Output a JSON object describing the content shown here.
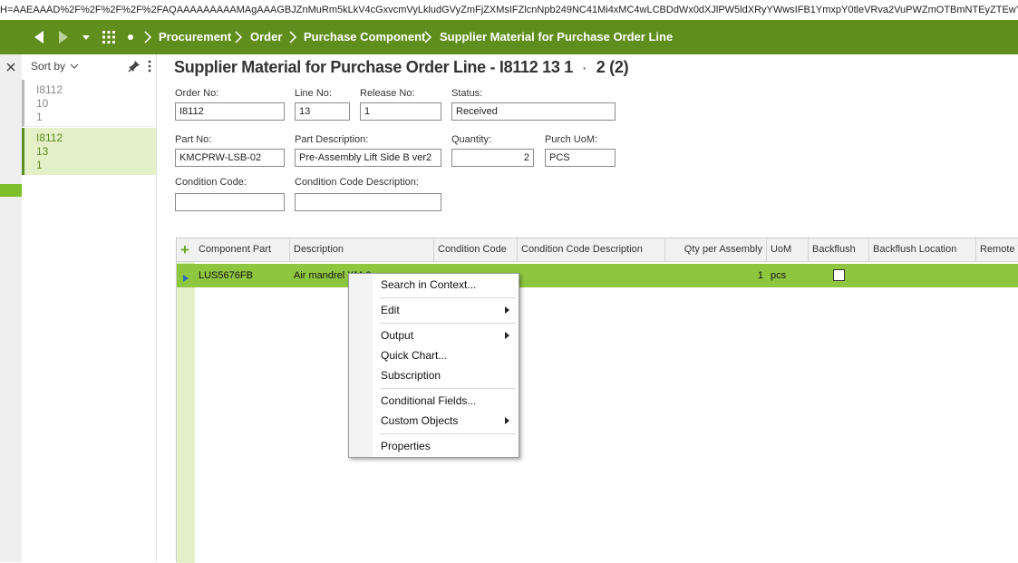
{
  "url": "H=AAEAAAD%2F%2F%2F%2F%2FAQAAAAAAAAAMAgAAAGBJZnMuRm5kLkV4cGxvcmVyLkludGVyZmFjZXMsIFZlcnNpb249NC41Mi4xMC4wLCBDdWx0dXJlPW5ldXRyYWwsIFB1YmxpY0tleVRva2VuPWZmOTBmNTEyZTEwYWVm",
  "nav": {
    "breadcrumbs": [
      "Procurement",
      "Order",
      "Purchase Component",
      "Supplier Material for Purchase Order Line"
    ]
  },
  "list_panel": {
    "sort_label": "Sort by",
    "records": [
      {
        "line1": "I8112",
        "line2": "10",
        "line3": "1",
        "selected": false
      },
      {
        "line1": "I8112",
        "line2": "13",
        "line3": "1",
        "selected": true
      }
    ]
  },
  "page": {
    "title": "Supplier Material for Purchase Order Line - I8112 13 1",
    "separator": "·",
    "count": "2 (2)"
  },
  "form": {
    "order_no": {
      "label": "Order No:",
      "value": "I8112"
    },
    "line_no": {
      "label": "Line No:",
      "value": "13"
    },
    "release_no": {
      "label": "Release No:",
      "value": "1"
    },
    "status": {
      "label": "Status:",
      "value": "Received"
    },
    "part_no": {
      "label": "Part No:",
      "value": "KMCPRW-LSB-02"
    },
    "part_description": {
      "label": "Part Description:",
      "value": "Pre-Assembly Lift Side B ver2"
    },
    "quantity": {
      "label": "Quantity:",
      "value": "2"
    },
    "purch_uom": {
      "label": "Purch UoM:",
      "value": "PCS"
    },
    "condition_code": {
      "label": "Condition Code:",
      "value": ""
    },
    "condition_code_description": {
      "label": "Condition Code Description:",
      "value": ""
    }
  },
  "grid": {
    "add_symbol": "+",
    "columns": [
      "Component Part",
      "Description",
      "Condition Code",
      "Condition Code Description",
      "Qty per Assembly",
      "UoM",
      "Backflush",
      "Backflush Location",
      "Remote W"
    ],
    "rows": [
      {
        "component_part": "LUS5676FB",
        "description": "Air mandrel KM-9",
        "condition_code": "",
        "condition_code_description": "",
        "qty_per_assembly": "1",
        "uom": "pcs",
        "backflush": false,
        "backflush_location": ""
      }
    ]
  },
  "context_menu": {
    "items": [
      {
        "label": "Search in Context...",
        "submenu": false
      },
      {
        "label": "Edit",
        "submenu": true
      },
      {
        "label": "Output",
        "submenu": true
      },
      {
        "label": "Quick Chart...",
        "submenu": false
      },
      {
        "label": "Subscription",
        "submenu": false
      },
      {
        "label": "Conditional Fields...",
        "submenu": false
      },
      {
        "label": "Custom Objects",
        "submenu": true
      },
      {
        "label": "Properties",
        "submenu": false
      }
    ]
  },
  "colors": {
    "nav_bar": "#5f8e1d",
    "selected_row": "#8ec640",
    "selected_record_bg": "#e3f0c8"
  }
}
